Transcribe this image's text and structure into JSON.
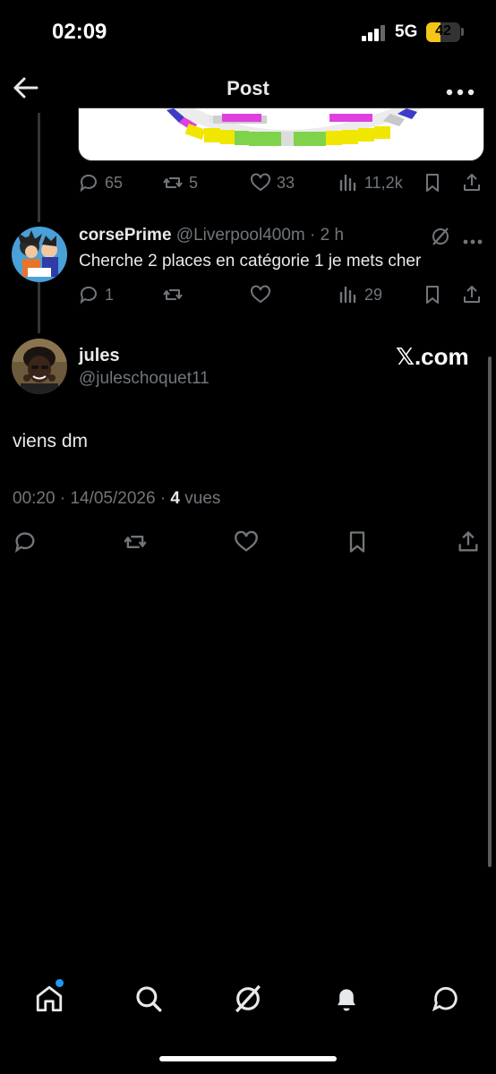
{
  "status_bar": {
    "time": "02:09",
    "network": "5G",
    "battery": "42",
    "battery_level": 0.42
  },
  "header": {
    "title": "Post",
    "back_icon": "arrow-left-icon",
    "more_icon": "more-horizontal-icon"
  },
  "previous_post": {
    "image_icon": "stadium-seating-map",
    "actions": {
      "replies": "65",
      "reposts": "5",
      "likes": "33",
      "views": "11,2k"
    }
  },
  "reply": {
    "name": "corsePrime",
    "handle": "@Liverpool400m",
    "separator": "·",
    "time": "2 h",
    "text": "Cherche 2 places en catégorie 1 je mets cher",
    "actions": {
      "replies": "1",
      "reposts": "",
      "likes": "",
      "views": "29"
    }
  },
  "main_post": {
    "name": "jules",
    "handle": "@juleschoquet11",
    "watermark": "𝕏.com",
    "text": "viens dm",
    "time": "00:20",
    "sep1": "·",
    "date": "14/05/2026",
    "sep2": "·",
    "views_count": "4",
    "views_label": "vues"
  },
  "bottom_nav": [
    "home-icon",
    "search-icon",
    "grok-icon",
    "notifications-icon",
    "messages-icon"
  ],
  "colors": {
    "background": "#000000",
    "text": "#e7e9ea",
    "muted": "#71767b",
    "accent": "#1d9bf0",
    "battery": "#f5c518"
  }
}
